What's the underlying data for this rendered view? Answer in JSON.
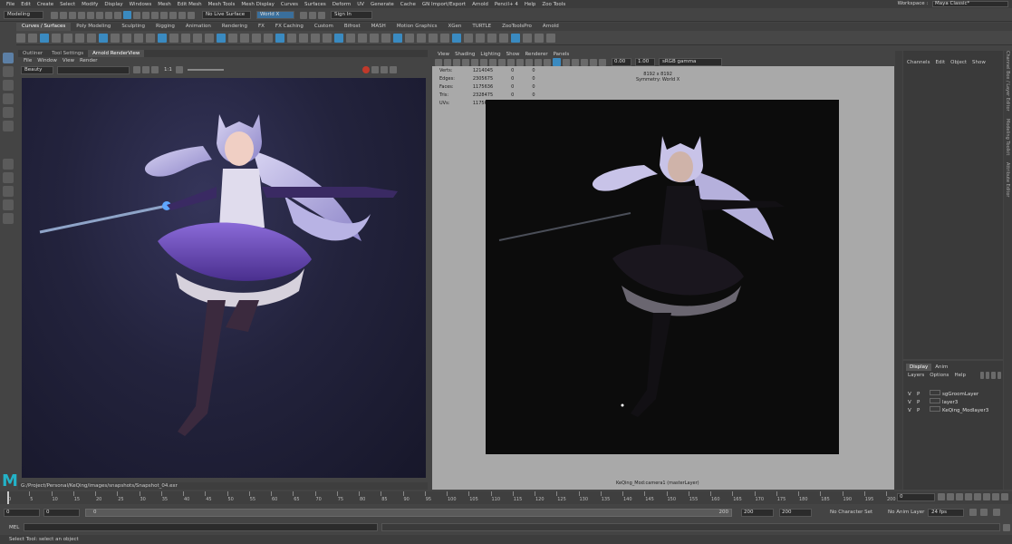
{
  "menubar": {
    "items": [
      "File",
      "Edit",
      "Create",
      "Select",
      "Modify",
      "Display",
      "Windows",
      "Mesh",
      "Edit Mesh",
      "Mesh Tools",
      "Mesh Display",
      "Curves",
      "Surfaces",
      "Deform",
      "UV",
      "Generate",
      "Cache",
      "GN Import/Export",
      "Arnold",
      "Pencil+ 4",
      "Help",
      "Zoo Tools"
    ],
    "workspace_label": "Workspace :",
    "workspace_value": "Maya Classic*"
  },
  "statusline": {
    "mode": "Modeling",
    "live_surface": "No Live Surface",
    "symmetry": "World X",
    "sign_in": "Sign In"
  },
  "shelf": {
    "tabs": [
      "Curves / Surfaces",
      "Poly Modeling",
      "Sculpting",
      "Rigging",
      "Animation",
      "Rendering",
      "FX",
      "FX Caching",
      "Custom",
      "Bifrost",
      "MASH",
      "Motion Graphics",
      "XGen",
      "TURTLE",
      "ZooToolsPro",
      "Arnold"
    ],
    "active": 0
  },
  "renderview": {
    "tabs": [
      "Outliner",
      "Tool Settings",
      "Arnold RenderView"
    ],
    "menu": [
      "File",
      "Window",
      "View",
      "Render"
    ],
    "aov": "Beauty",
    "ratio": "1:1",
    "path": "G:/Project/Personal/KeQing/images/snapshots/Snapshot_04.exr"
  },
  "viewport": {
    "menu": [
      "View",
      "Shading",
      "Lighting",
      "Show",
      "Renderer",
      "Panels"
    ],
    "exposure": "0.00",
    "gamma": "1.00",
    "colorspace": "sRGB gamma",
    "hud": [
      {
        "label": "Verts:",
        "a": "1214045",
        "b": "0",
        "c": "0"
      },
      {
        "label": "Edges:",
        "a": "2305675",
        "b": "0",
        "c": "0"
      },
      {
        "label": "Faces:",
        "a": "1175636",
        "b": "0",
        "c": "0"
      },
      {
        "label": "Tris:",
        "a": "2328475",
        "b": "0",
        "c": "0"
      },
      {
        "label": "UVs:",
        "a": "1175665",
        "b": "0",
        "c": "0"
      }
    ],
    "resolution": "8192 x 8192",
    "symmetry": "Symmetry: World X",
    "camera_label": "KeQing_Mod:camera1 (masterLayer)"
  },
  "channelbox": {
    "menu": [
      "Channels",
      "Edit",
      "Object",
      "Show"
    ],
    "side_tabs": [
      "Channel Box / Layer Editor",
      "Modeling Toolkit",
      "Attribute Editor",
      "Tool Settings",
      "XGen"
    ]
  },
  "layers": {
    "tabs": [
      "Display",
      "Anim"
    ],
    "menu": [
      "Layers",
      "Options",
      "Help"
    ],
    "rows": [
      {
        "v": "V",
        "p": "P",
        "name": "sgGroomLayer"
      },
      {
        "v": "V",
        "p": "P",
        "name": "layer3"
      },
      {
        "v": "V",
        "p": "P",
        "name": "KeQing_Modlayer3"
      }
    ]
  },
  "timeline": {
    "current_frame": "0",
    "ticks": [
      "0",
      "5",
      "10",
      "15",
      "20",
      "25",
      "30",
      "35",
      "40",
      "45",
      "50",
      "55",
      "60",
      "65",
      "70",
      "75",
      "80",
      "85",
      "90",
      "95",
      "100",
      "105",
      "110",
      "115",
      "120",
      "125",
      "130",
      "135",
      "140",
      "145",
      "150",
      "155",
      "160",
      "165",
      "170",
      "175",
      "180",
      "185",
      "190",
      "195",
      "200"
    ]
  },
  "range": {
    "start": "0",
    "start2": "0",
    "slider_start": "0",
    "slider_end": "200",
    "end": "200",
    "end2": "200",
    "character_set": "No Character Set",
    "anim_layer": "No Anim Layer",
    "fps": "24 fps"
  },
  "cmdline": {
    "label": "MEL"
  },
  "helpline": {
    "text": "Select Tool: select an object"
  },
  "colors": {
    "accent": "#3a8ac0",
    "maya_logo": "#23b3c8"
  }
}
